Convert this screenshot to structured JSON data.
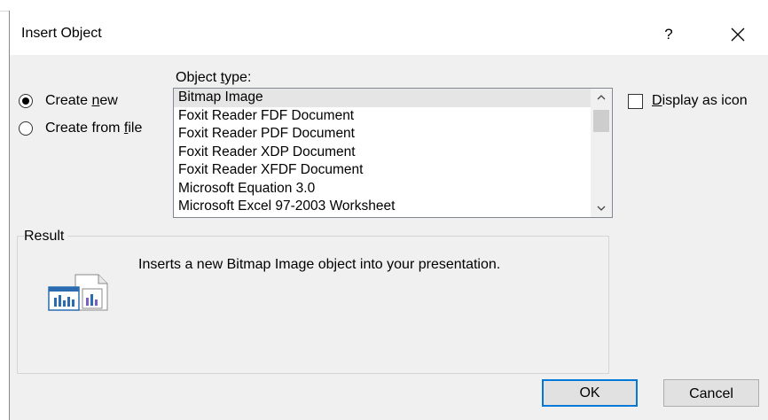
{
  "dialog": {
    "title": "Insert Object",
    "help_label": "?",
    "close_icon": "close-icon"
  },
  "source": {
    "create_new": {
      "prefix": "Create ",
      "accel": "n",
      "suffix": "ew",
      "checked": true
    },
    "create_from_file": {
      "prefix": "Create from ",
      "accel": "f",
      "suffix": "ile",
      "checked": false
    }
  },
  "object_type": {
    "label_prefix": "Object ",
    "label_accel": "t",
    "label_suffix": "ype:",
    "items": [
      "Bitmap Image",
      "Foxit Reader FDF Document",
      "Foxit Reader PDF Document",
      "Foxit Reader XDP Document",
      "Foxit Reader XFDF Document",
      "Microsoft Equation 3.0",
      "Microsoft Excel 97-2003 Worksheet"
    ],
    "selected": "Bitmap Image"
  },
  "display_as_icon": {
    "accel": "D",
    "suffix": "isplay as icon",
    "checked": false
  },
  "result": {
    "label": "Result",
    "text": "Inserts a new Bitmap Image object into your presentation.",
    "icon": "bitmap-object-icon"
  },
  "buttons": {
    "ok": "OK",
    "cancel": "Cancel"
  },
  "colors": {
    "default_button_border": "#0078d7",
    "dialog_bg": "#f0f0f0",
    "selected_item_bg": "#e5e5e5"
  }
}
